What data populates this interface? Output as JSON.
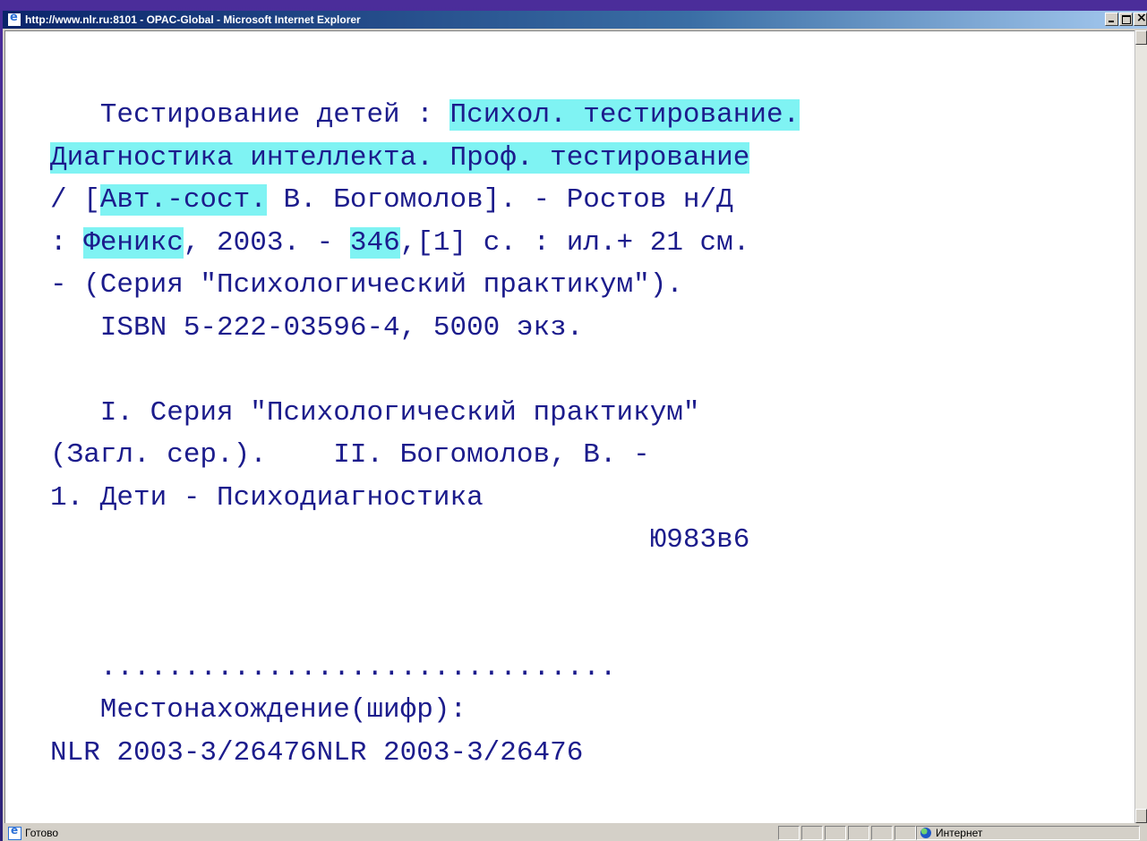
{
  "window": {
    "title": "http://www.nlr.ru:8101 - OPAC-Global - Microsoft Internet Explorer"
  },
  "record": {
    "lines": [
      [
        {
          "t": "   Тестирование детей : "
        },
        {
          "t": "Психол. тестирование.",
          "hl": true
        }
      ],
      [
        {
          "t": "Диагностика интеллекта. Проф. тестирование",
          "hl": true
        }
      ],
      [
        {
          "t": "/ ["
        },
        {
          "t": "Авт.-сост.",
          "hl": true
        },
        {
          "t": " В. Богомолов]. - Ростов н/Д"
        }
      ],
      [
        {
          "t": ": "
        },
        {
          "t": "Феникс",
          "hl": true
        },
        {
          "t": ", 2003. - "
        },
        {
          "t": "346",
          "hl": true
        },
        {
          "t": ",[1] с. : ил.+ 21 см."
        }
      ],
      [
        {
          "t": "- (Серия \"Психологический практикум\")."
        }
      ],
      [
        {
          "t": "   ISBN 5-222-03596-4, 5000 экз."
        }
      ],
      [
        {
          "t": ""
        }
      ],
      [
        {
          "t": "   I. Серия \"Психологический практикум\""
        }
      ],
      [
        {
          "t": "(Загл. сер.).    II. Богомолов, В. -"
        }
      ],
      [
        {
          "t": "1. Дети - Психодиагностика"
        }
      ],
      [
        {
          "t": "                                    Ю983в6"
        }
      ],
      [
        {
          "t": ""
        }
      ],
      [
        {
          "t": ""
        }
      ],
      [
        {
          "t": "   ..............................."
        }
      ],
      [
        {
          "t": "   Местонахождение(шифр):"
        }
      ],
      [
        {
          "t": "NLR 2003-3/26476NLR 2003-3/26476"
        }
      ]
    ]
  },
  "statusbar": {
    "status_text": "Готово",
    "zone_text": "Интернет"
  },
  "colors": {
    "text": "#1c1c8c",
    "highlight": "#7ff3f3",
    "titlebar": "#0a246a"
  }
}
